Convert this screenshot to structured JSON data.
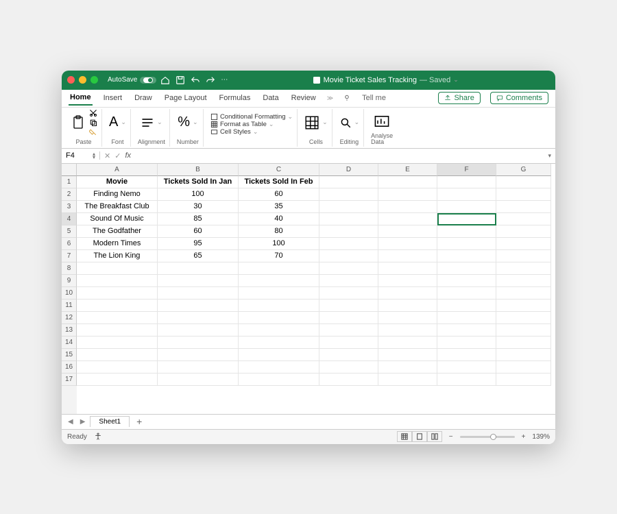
{
  "titlebar": {
    "autosave": "AutoSave",
    "filename": "Movie Ticket Sales Tracking",
    "saved": "— Saved"
  },
  "tabs": {
    "home": "Home",
    "insert": "Insert",
    "draw": "Draw",
    "pageLayout": "Page Layout",
    "formulas": "Formulas",
    "data": "Data",
    "review": "Review",
    "tellme": "Tell me",
    "share": "Share",
    "comments": "Comments"
  },
  "ribbon": {
    "paste": "Paste",
    "font": "Font",
    "alignment": "Alignment",
    "number": "Number",
    "condFmt": "Conditional Formatting",
    "fmtTable": "Format as Table",
    "cellStyles": "Cell Styles",
    "cells": "Cells",
    "editing": "Editing",
    "analyse": "Analyse",
    "data2": "Data"
  },
  "nameBox": "F4",
  "columns": [
    "A",
    "B",
    "C",
    "D",
    "E",
    "F",
    "G"
  ],
  "colWidths": [
    "wA",
    "wB",
    "wC",
    "wD",
    "wE",
    "wF",
    "wG"
  ],
  "rowCount": 17,
  "selected": {
    "row": 4,
    "col": 5
  },
  "cells": {
    "1": [
      "Movie",
      "Tickets Sold In Jan",
      "Tickets Sold In Feb",
      "",
      "",
      "",
      ""
    ],
    "2": [
      "Finding Nemo",
      "100",
      "60",
      "",
      "",
      "",
      ""
    ],
    "3": [
      "The Breakfast Club",
      "30",
      "35",
      "",
      "",
      "",
      ""
    ],
    "4": [
      "Sound Of Music",
      "85",
      "40",
      "",
      "",
      "",
      ""
    ],
    "5": [
      "The Godfather",
      "60",
      "80",
      "",
      "",
      "",
      ""
    ],
    "6": [
      "Modern Times",
      "95",
      "100",
      "",
      "",
      "",
      ""
    ],
    "7": [
      "The Lion King",
      "65",
      "70",
      "",
      "",
      "",
      ""
    ]
  },
  "sheet": "Sheet1",
  "status": {
    "ready": "Ready",
    "zoom": "139%"
  }
}
